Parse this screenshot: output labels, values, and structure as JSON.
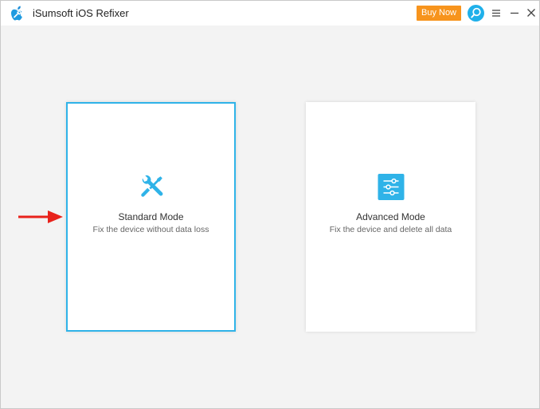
{
  "app": {
    "title": "iSumsoft iOS Refixer",
    "logo_icon": "apple-wrench-icon"
  },
  "titlebar": {
    "buy_label": "Buy Now",
    "buy_color": "#f7941d",
    "search_icon": "search-icon",
    "menu_icon": "menu-icon",
    "minimize_icon": "minimize-icon",
    "close_icon": "close-icon"
  },
  "modes": [
    {
      "title": "Standard Mode",
      "description": "Fix the device without data loss",
      "icon": "tools-icon",
      "selected": true
    },
    {
      "title": "Advanced Mode",
      "description": "Fix the device and delete all data",
      "icon": "sliders-icon",
      "selected": false
    }
  ],
  "colors": {
    "accent": "#2fb3e8",
    "annotation_arrow": "#e8221b"
  }
}
